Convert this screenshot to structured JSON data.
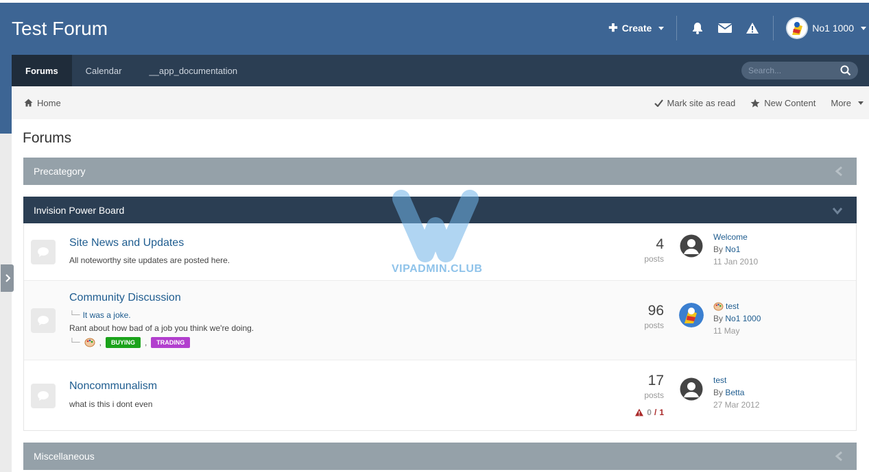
{
  "header": {
    "site_title": "Test Forum",
    "create_label": "Create",
    "user_name": "No1 1000"
  },
  "nav": {
    "tabs": [
      {
        "label": "Forums",
        "active": true
      },
      {
        "label": "Calendar",
        "active": false
      },
      {
        "label": "__app_documentation",
        "active": false
      }
    ],
    "search_placeholder": "Search..."
  },
  "breadcrumb": {
    "home": "Home",
    "mark_read": "Mark site as read",
    "new_content": "New Content",
    "more": "More"
  },
  "page": {
    "title": "Forums"
  },
  "categories": [
    {
      "title": "Precategory",
      "collapsed": true
    },
    {
      "title": "Invision Power Board",
      "collapsed": false
    },
    {
      "title": "Miscellaneous",
      "collapsed": true
    }
  ],
  "forums": [
    {
      "name": "Site News and Updates",
      "description": "All noteworthy site updates are posted here.",
      "posts": "4",
      "posts_label": "posts",
      "last_title": "Welcome",
      "last_by_prefix": "By",
      "last_by": "No1",
      "last_date": "11 Jan 2010"
    },
    {
      "name": "Community Discussion",
      "subforum": "It was a joke.",
      "description": "Rant about how bad of a job you think we're doing.",
      "tags": [
        {
          "label": "BUYING",
          "color": "#1ba31b"
        },
        {
          "label": "TRADING",
          "color": "#b23fce"
        }
      ],
      "posts": "96",
      "posts_label": "posts",
      "last_title": "test",
      "last_by_prefix": "By",
      "last_by": "No1 1000",
      "last_date": "11 May"
    },
    {
      "name": "Noncommunalism",
      "description": "what is this i dont even",
      "posts": "17",
      "posts_label": "posts",
      "reports_zero": "0",
      "reports_sep": "/",
      "reports_total": "1",
      "last_title": "test",
      "last_by_prefix": "By",
      "last_by": "Betta",
      "last_date": "27 Mar 2012"
    }
  ],
  "watermark": "VIPADMIN.CLUB",
  "colors": {
    "brand": "#3d6594",
    "nav": "#2b3e53",
    "link": "#1e5c8f",
    "category_grey": "#95a1a9"
  }
}
